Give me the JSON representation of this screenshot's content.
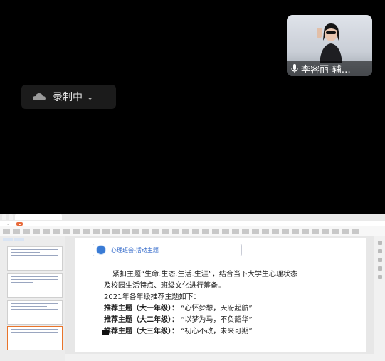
{
  "participant": {
    "name": "李容丽-辅…",
    "mic_icon": "microphone-icon"
  },
  "recording": {
    "label": "录制中",
    "chevron": "⌄",
    "icon": "cloud-icon"
  },
  "document": {
    "heading": "心理班会-活动主题",
    "paragraph_line1": "紧扣主题“生命.生态.生活.生涯”，结合当下大学生心理状态",
    "paragraph_line2": "及校园生活特点、班级文化进行筹备。",
    "intro": "2021年各年级推荐主题如下：",
    "recommendations": [
      {
        "label": "推荐主题（大一年级）：",
        "value": "“心怀梦想，天府起航”"
      },
      {
        "label": "推荐主题（大二年级）：",
        "value": "“以梦为马，不负韶华”"
      },
      {
        "label": "推荐主题（大三年级）：",
        "value": "“初心不改，未来可期”"
      }
    ]
  },
  "colors": {
    "heading_blue": "#2f67c9",
    "accent_orange": "#e86a3a"
  }
}
